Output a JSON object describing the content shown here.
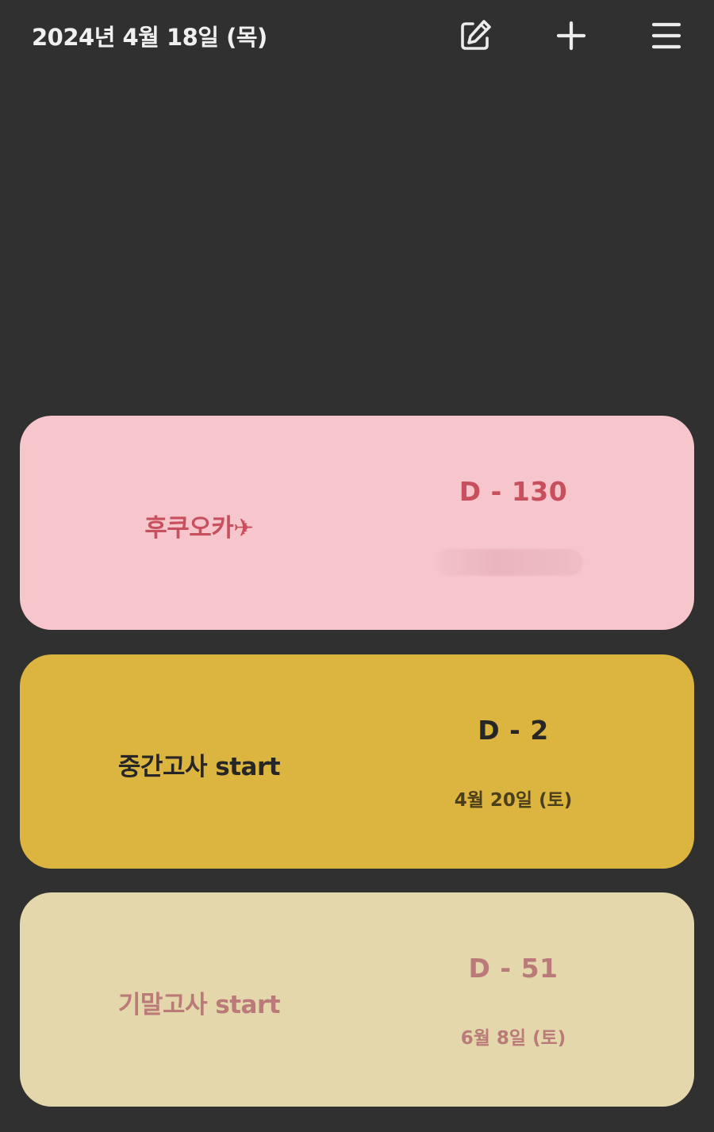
{
  "header": {
    "date": "2024년 4월 18일 (목)",
    "icons": {
      "edit": "edit-icon",
      "add": "plus-icon",
      "menu": "hamburger-menu-icon"
    },
    "text_color": "#f0f0f0"
  },
  "background_color": "#303030",
  "cards": [
    {
      "title": "후쿠오카✈",
      "dday": "D - 130",
      "date": "",
      "date_blurred": true,
      "bg_color": "#f7c6cc",
      "text_color": "#c8505e"
    },
    {
      "title": "중간고사 start",
      "dday": "D - 2",
      "date": "4월 20일 (토)",
      "bg_color": "#dbb53f",
      "text_color": "#262626",
      "date_color": "#4a3f1a"
    },
    {
      "title": "기말고사 start",
      "dday": "D - 51",
      "date": "6월 8일 (토)",
      "bg_color": "#e4d7ab",
      "text_color": "#bb7a7a"
    }
  ]
}
